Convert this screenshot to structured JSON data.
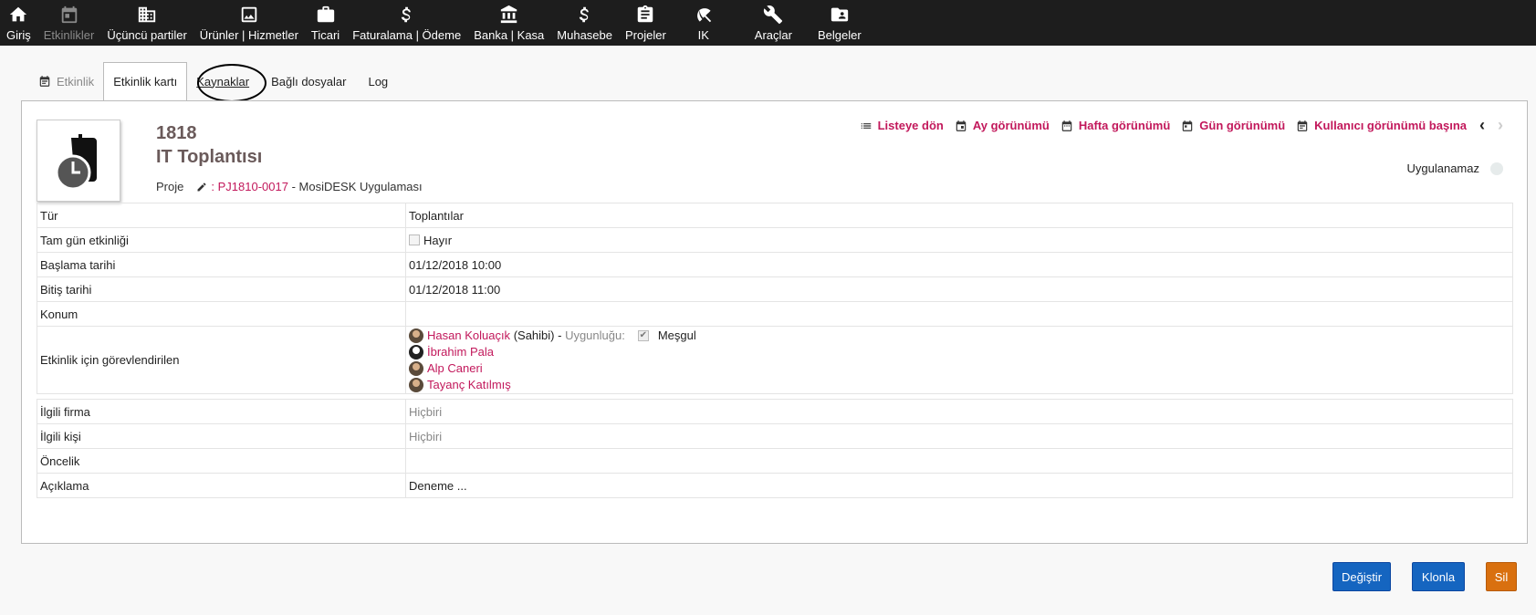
{
  "nav": [
    {
      "label": "Giriş",
      "icon": "home-icon",
      "dim": false
    },
    {
      "label": "Etkinlikler",
      "icon": "calendar-icon",
      "dim": true
    },
    {
      "label": "Üçüncü partiler",
      "icon": "building-icon",
      "dim": false
    },
    {
      "label": "Ürünler | Hizmetler",
      "icon": "image-icon",
      "dim": false
    },
    {
      "label": "Ticari",
      "icon": "briefcase-icon",
      "dim": false
    },
    {
      "label": "Faturalama | Ödeme",
      "icon": "dollar-icon",
      "dim": false
    },
    {
      "label": "Banka | Kasa",
      "icon": "bank-icon",
      "dim": false
    },
    {
      "label": "Muhasebe",
      "icon": "dollar-icon",
      "dim": false
    },
    {
      "label": "Projeler",
      "icon": "clipboard-icon",
      "dim": false
    },
    {
      "label": "IK",
      "icon": "umbrella-icon",
      "dim": false
    },
    {
      "label": "Araçlar",
      "icon": "wrench-icon",
      "dim": false
    },
    {
      "label": "Belgeler",
      "icon": "folder-user-icon",
      "dim": false
    }
  ],
  "tabs": {
    "etkinlik": "Etkinlik",
    "kart": "Etkinlik kartı",
    "kaynaklar": "Kaynaklar",
    "dosyalar": "Bağlı dosyalar",
    "log": "Log"
  },
  "event": {
    "ref": "1818",
    "title": "IT Toplantısı",
    "project_label": "Proje",
    "project_sep": ":",
    "project_ref": "PJ1810-0017",
    "project_name": "- MosiDESK Uygulaması"
  },
  "views": {
    "list": "Listeye dön",
    "month": "Ay görünümü",
    "week": "Hafta görünümü",
    "day": "Gün görünümü",
    "user": "Kullanıcı görünümü başına"
  },
  "status": "Uygulanamaz",
  "fields1": {
    "tur": {
      "k": "Tür",
      "v": "Toplantılar"
    },
    "tamgun": {
      "k": "Tam gün etkinliği",
      "v": "Hayır"
    },
    "baslama": {
      "k": "Başlama tarihi",
      "v": "01/12/2018 10:00"
    },
    "bitis": {
      "k": "Bitiş tarihi",
      "v": "01/12/2018 11:00"
    },
    "konum": {
      "k": "Konum",
      "v": ""
    },
    "gorevli": {
      "k": "Etkinlik için görevlendirilen"
    }
  },
  "assignees": {
    "owner": "Hasan Koluaçık",
    "owner_role": "(Sahibi) -",
    "availability_label": "Uygunluğu:",
    "availability": "Meşgul",
    "u2": "İbrahim Pala",
    "u3": "Alp Caneri",
    "u4": "Tayanç Katılmış"
  },
  "fields2": {
    "firma": {
      "k": "İlgili firma",
      "v": "Hiçbiri"
    },
    "kisi": {
      "k": "İlgili kişi",
      "v": "Hiçbiri"
    },
    "oncelik": {
      "k": "Öncelik",
      "v": ""
    },
    "aciklama": {
      "k": "Açıklama",
      "v": "Deneme ..."
    }
  },
  "buttons": {
    "edit": "Değiştir",
    "clone": "Klonla",
    "delete": "Sil"
  }
}
